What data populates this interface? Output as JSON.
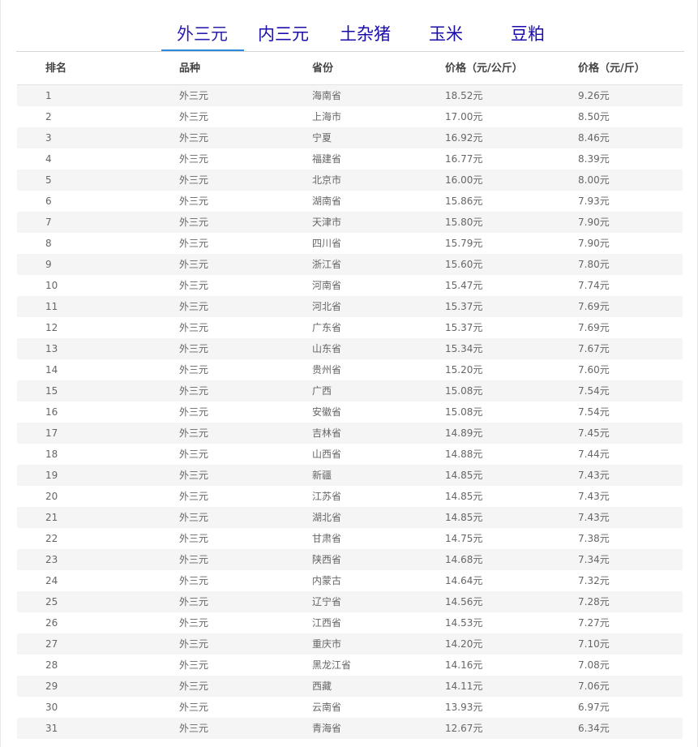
{
  "tabs": [
    {
      "label": "外三元",
      "active": true
    },
    {
      "label": "内三元",
      "active": false
    },
    {
      "label": "土杂猪",
      "active": false
    },
    {
      "label": "玉米",
      "active": false
    },
    {
      "label": "豆粕",
      "active": false
    }
  ],
  "table": {
    "headers": [
      "排名",
      "品种",
      "省份",
      "价格（元/公斤）",
      "价格（元/斤）"
    ],
    "rows": [
      [
        "1",
        "外三元",
        "海南省",
        "18.52元",
        "9.26元"
      ],
      [
        "2",
        "外三元",
        "上海市",
        "17.00元",
        "8.50元"
      ],
      [
        "3",
        "外三元",
        "宁夏",
        "16.92元",
        "8.46元"
      ],
      [
        "4",
        "外三元",
        "福建省",
        "16.77元",
        "8.39元"
      ],
      [
        "5",
        "外三元",
        "北京市",
        "16.00元",
        "8.00元"
      ],
      [
        "6",
        "外三元",
        "湖南省",
        "15.86元",
        "7.93元"
      ],
      [
        "7",
        "外三元",
        "天津市",
        "15.80元",
        "7.90元"
      ],
      [
        "8",
        "外三元",
        "四川省",
        "15.79元",
        "7.90元"
      ],
      [
        "9",
        "外三元",
        "浙江省",
        "15.60元",
        "7.80元"
      ],
      [
        "10",
        "外三元",
        "河南省",
        "15.47元",
        "7.74元"
      ],
      [
        "11",
        "外三元",
        "河北省",
        "15.37元",
        "7.69元"
      ],
      [
        "12",
        "外三元",
        "广东省",
        "15.37元",
        "7.69元"
      ],
      [
        "13",
        "外三元",
        "山东省",
        "15.34元",
        "7.67元"
      ],
      [
        "14",
        "外三元",
        "贵州省",
        "15.20元",
        "7.60元"
      ],
      [
        "15",
        "外三元",
        "广西",
        "15.08元",
        "7.54元"
      ],
      [
        "16",
        "外三元",
        "安徽省",
        "15.08元",
        "7.54元"
      ],
      [
        "17",
        "外三元",
        "吉林省",
        "14.89元",
        "7.45元"
      ],
      [
        "18",
        "外三元",
        "山西省",
        "14.88元",
        "7.44元"
      ],
      [
        "19",
        "外三元",
        "新疆",
        "14.85元",
        "7.43元"
      ],
      [
        "20",
        "外三元",
        "江苏省",
        "14.85元",
        "7.43元"
      ],
      [
        "21",
        "外三元",
        "湖北省",
        "14.85元",
        "7.43元"
      ],
      [
        "22",
        "外三元",
        "甘肃省",
        "14.75元",
        "7.38元"
      ],
      [
        "23",
        "外三元",
        "陕西省",
        "14.68元",
        "7.34元"
      ],
      [
        "24",
        "外三元",
        "内蒙古",
        "14.64元",
        "7.32元"
      ],
      [
        "25",
        "外三元",
        "辽宁省",
        "14.56元",
        "7.28元"
      ],
      [
        "26",
        "外三元",
        "江西省",
        "14.53元",
        "7.27元"
      ],
      [
        "27",
        "外三元",
        "重庆市",
        "14.20元",
        "7.10元"
      ],
      [
        "28",
        "外三元",
        "黑龙江省",
        "14.16元",
        "7.08元"
      ],
      [
        "29",
        "外三元",
        "西藏",
        "14.11元",
        "7.06元"
      ],
      [
        "30",
        "外三元",
        "云南省",
        "13.93元",
        "6.97元"
      ],
      [
        "31",
        "外三元",
        "青海省",
        "12.67元",
        "6.34元"
      ]
    ]
  }
}
